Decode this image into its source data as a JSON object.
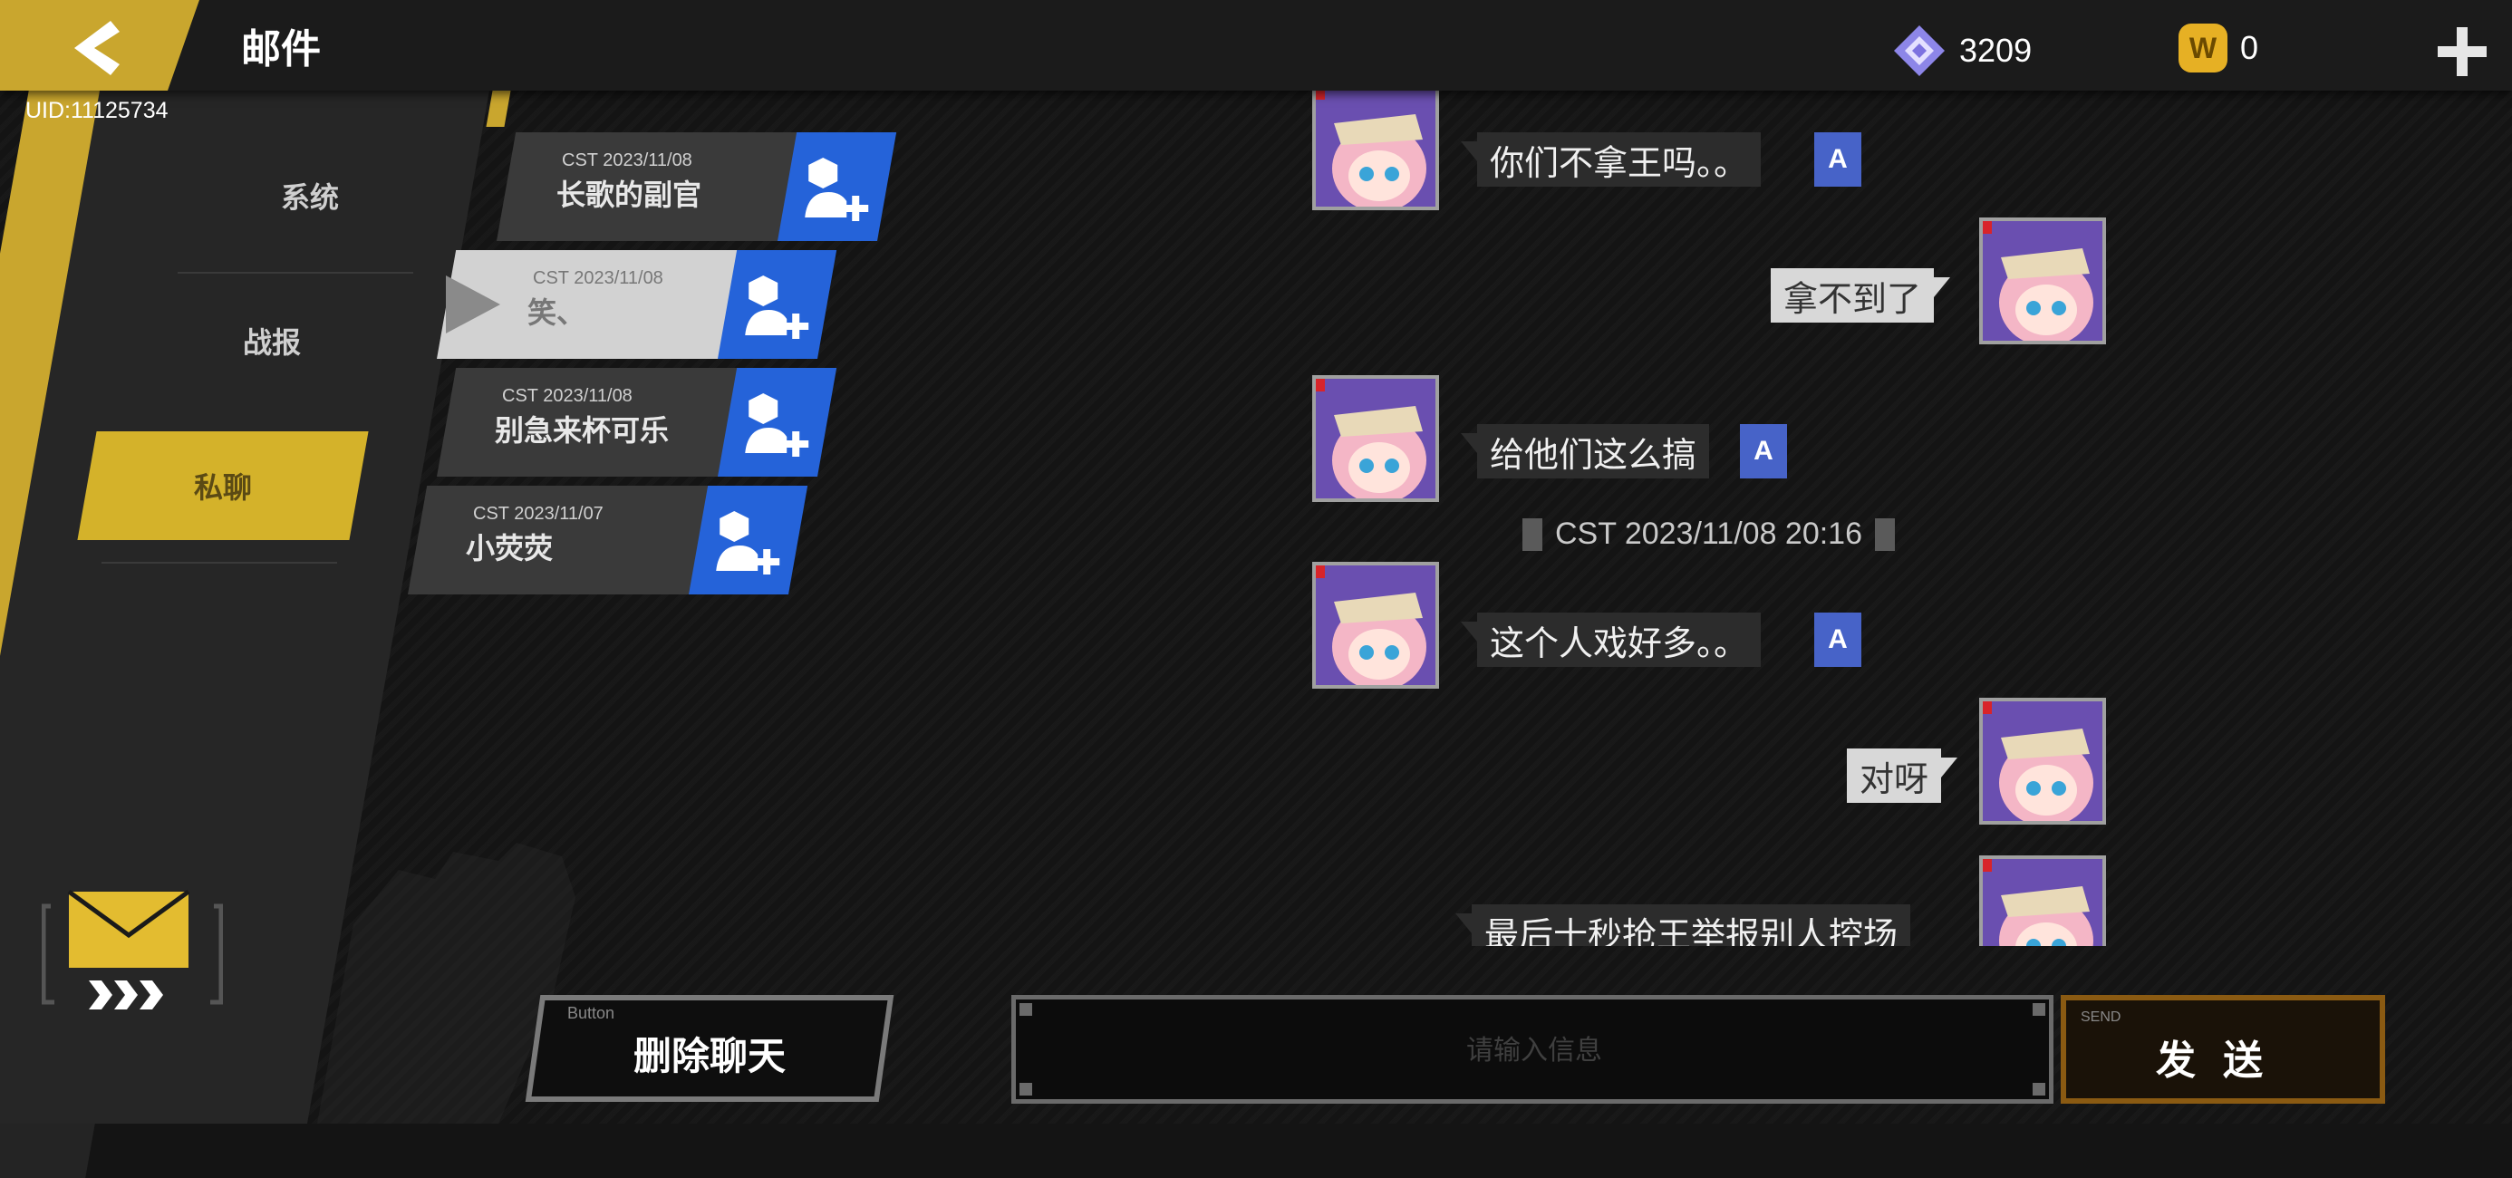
{
  "header": {
    "title": "邮件",
    "uid": "UID:11125734"
  },
  "currency": {
    "gems": "3209",
    "coins": "0",
    "coin_glyph": "W"
  },
  "nav": {
    "items": [
      {
        "label": "系统"
      },
      {
        "label": "战报"
      },
      {
        "label": "私聊"
      }
    ],
    "active_index": 2
  },
  "contacts": [
    {
      "date": "CST 2023/11/08",
      "name": "长歌的副官"
    },
    {
      "date": "CST 2023/11/08",
      "name": "笑、"
    },
    {
      "date": "CST 2023/11/08",
      "name": "别急来杯可乐"
    },
    {
      "date": "CST 2023/11/07",
      "name": "小荧荧"
    }
  ],
  "selected_contact_index": 1,
  "chat": {
    "messages": [
      {
        "side": "left",
        "text": "你们不拿王吗。。",
        "translate": "A"
      },
      {
        "side": "right",
        "text": "拿不到了"
      },
      {
        "side": "left",
        "text": "给他们这么搞",
        "translate": "A"
      },
      {
        "side": "left",
        "text": "这个人戏好多。。",
        "translate": "A"
      },
      {
        "side": "right",
        "text": "对呀"
      },
      {
        "side": "right",
        "text": "最后十秒抢王举报别人控场"
      }
    ],
    "timestamp": "CST 2023/11/08 20:16"
  },
  "bottom": {
    "delete_small": "Button",
    "delete_label": "删除聊天",
    "input_placeholder": "请输入信息",
    "send_small": "SEND",
    "send_label": "发送"
  },
  "colors": {
    "accent_yellow": "#c9a62e",
    "add_blue": "#2563d9",
    "translate_blue": "#4763c8",
    "send_border": "#8a5a12"
  },
  "icons": [
    "back-arrow-icon",
    "gem-icon",
    "coin-icon",
    "plus-icon",
    "add-friend-icon",
    "mail-icon",
    "translate-icon"
  ]
}
